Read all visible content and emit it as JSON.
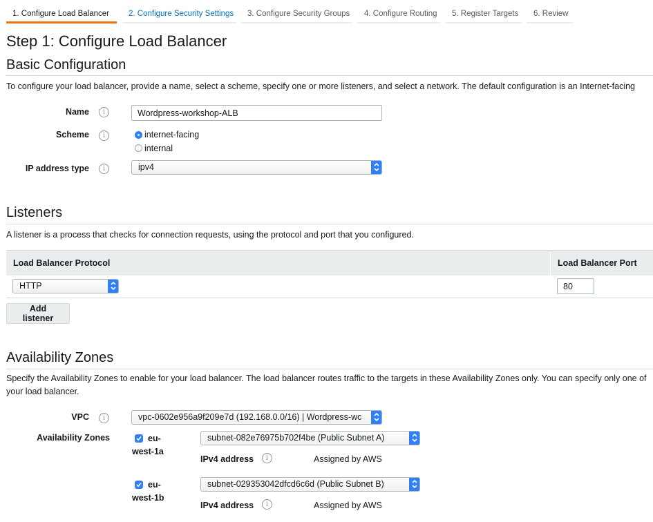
{
  "tabs": [
    {
      "label": "1. Configure Load Balancer"
    },
    {
      "label": "2. Configure Security Settings"
    },
    {
      "label": "3. Configure Security Groups"
    },
    {
      "label": "4. Configure Routing"
    },
    {
      "label": "5. Register Targets"
    },
    {
      "label": "6. Review"
    }
  ],
  "page_title": "Step 1: Configure Load Balancer",
  "basic": {
    "heading": "Basic Configuration",
    "description": "To configure your load balancer, provide a name, select a scheme, specify one or more listeners, and select a network. The default configuration is an Internet-facing",
    "name_label": "Name",
    "name_value": "Wordpress-workshop-ALB",
    "scheme_label": "Scheme",
    "scheme_options": [
      "internet-facing",
      "internal"
    ],
    "scheme_selected": "internet-facing",
    "ip_label": "IP address type",
    "ip_value": "ipv4"
  },
  "listeners": {
    "heading": "Listeners",
    "description": "A listener is a process that checks for connection requests, using the protocol and port that you configured.",
    "col_protocol": "Load Balancer Protocol",
    "col_port": "Load Balancer Port",
    "rows": [
      {
        "protocol": "HTTP",
        "port": "80"
      }
    ],
    "add_button": "Add listener"
  },
  "az": {
    "heading": "Availability Zones",
    "description": "Specify the Availability Zones to enable for your load balancer. The load balancer routes traffic to the targets in these Availability Zones only. You can specify only one of your load balancer.",
    "vpc_label": "VPC",
    "vpc_value": "vpc-0602e956a9f209e7d (192.168.0.0/16) | Wordpress-wc",
    "zones_label": "Availability Zones",
    "zones": [
      {
        "zone_line1": "eu-",
        "zone_line2": "west-1a",
        "checked": true,
        "subnet": "subnet-082e76975b702f4be (Public Subnet A)",
        "ipv4_label": "IPv4 address",
        "ipv4_value": "Assigned by AWS"
      },
      {
        "zone_line1": "eu-",
        "zone_line2": "west-1b",
        "checked": true,
        "subnet": "subnet-029353042dfcd6c6d (Public Subnet B)",
        "ipv4_label": "IPv4 address",
        "ipv4_value": "Assigned by AWS"
      }
    ]
  },
  "icons": {
    "info": "info-icon",
    "select": "select-arrows-icon",
    "check": "checkmark-icon"
  },
  "colors": {
    "accent": "#ec7211",
    "link": "#0073bb",
    "control_blue": "#2f7ff7"
  }
}
